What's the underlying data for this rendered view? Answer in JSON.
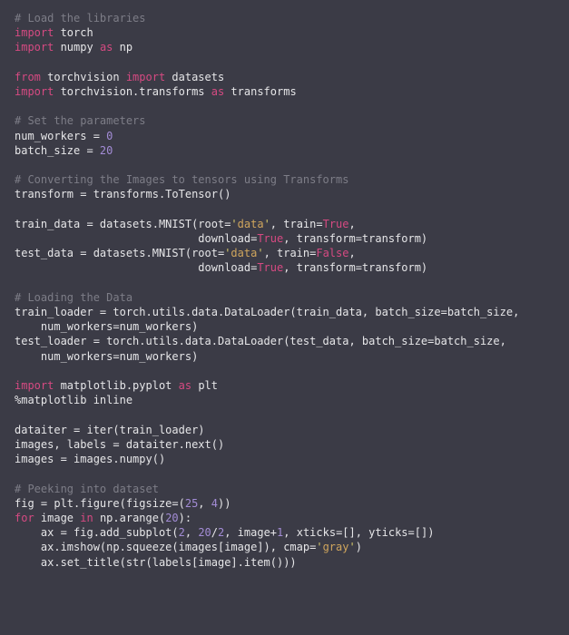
{
  "code": {
    "c1": "# Load the libraries",
    "kw_import": "import",
    "kw_from": "from",
    "kw_as": "as",
    "kw_for": "for",
    "kw_in": "in",
    "torch": " torch",
    "numpy_as_np": " numpy ",
    "np": " np",
    "blank": "",
    "torchvision": " torchvision ",
    "datasets": " datasets",
    "torchvision_transforms": " torchvision.transforms ",
    "transforms": " transforms",
    "c2": "# Set the parameters",
    "num_workers_lhs": "num_workers = ",
    "zero": "0",
    "batch_size_lhs": "batch_size = ",
    "twenty": "20",
    "c3": "# Converting the Images to tensors using Transforms",
    "transform_line": "transform = transforms.ToTensor()",
    "train_data_a": "train_data = datasets.MNIST(root=",
    "q": "'",
    "data_str": "data",
    "comma_train": ", train=",
    "true": "True",
    "comma": ",",
    "indent_dl": "                            download=",
    "comma_transform": ", transform=transform)",
    "test_data_a": "test_data = datasets.MNIST(root=",
    "false": "False",
    "c4": "# Loading the Data",
    "train_loader": "train_loader = torch.utils.data.DataLoader(train_data, batch_size=batch_size,",
    "indent_nw": "    num_workers=num_workers)",
    "test_loader": "test_loader = torch.utils.data.DataLoader(test_data, batch_size=batch_size,",
    "mpl": " matplotlib.pyplot ",
    "plt": " plt",
    "magic": "%matplotlib inline",
    "dataiter": "dataiter = iter(train_loader)",
    "images_labels": "images, labels = dataiter.next()",
    "images_numpy": "images = images.numpy()",
    "c5": "# Peeking into dataset",
    "fig_a": "fig = plt.figure(figsize=(",
    "n25": "25",
    "sep": ", ",
    "n4": "4",
    "close2": "))",
    "for_image": " image ",
    "np_arange": " np.arange(",
    "n20b": "20",
    "close_colon": "):",
    "ax_a": "    ax = fig.add_subplot(",
    "n2": "2",
    "n20c": "20",
    "slash": "/",
    "n2b": "2",
    "image_plus": ", image+",
    "n1": "1",
    "xt_yt": ", xticks=[], yticks=[])",
    "ax_imshow_a": "    ax.imshow(np.squeeze(images[image]), cmap=",
    "gray": "gray",
    "close1": ")",
    "ax_title": "    ax.set_title(str(labels[image].item()))"
  }
}
